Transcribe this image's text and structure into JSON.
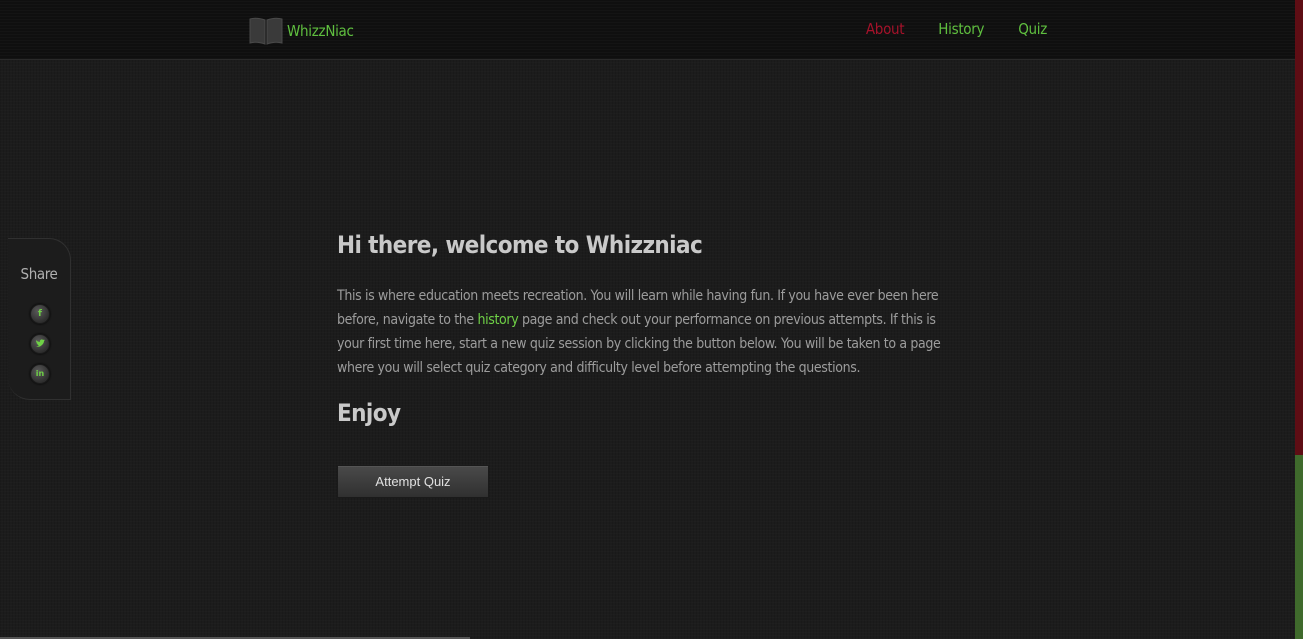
{
  "brand": {
    "name": "WhizzNiac",
    "icon": "book-icon"
  },
  "nav": {
    "items": [
      {
        "label": "About",
        "active": true
      },
      {
        "label": "History",
        "active": false
      },
      {
        "label": "Quiz",
        "active": false
      }
    ]
  },
  "share": {
    "title": "Share",
    "items": [
      {
        "icon": "facebook-icon",
        "glyph": "f"
      },
      {
        "icon": "twitter-icon",
        "glyph": "t"
      },
      {
        "icon": "linkedin-icon",
        "glyph": "in"
      }
    ]
  },
  "main": {
    "heading": "Hi there, welcome to Whizzniac",
    "intro_before_link": "This is where education meets recreation. You will learn while having fun. If you have ever been here before, navigate to the ",
    "intro_link": "history",
    "intro_after_link": " page and check out your performance on previous attempts. If this is your first time here, start a new quiz session by clicking the button below. You will be taken to a page where you will select quiz category and difficulty level before attempting the questions.",
    "subheading": "Enjoy",
    "button_label": "Attempt Quiz"
  },
  "colors": {
    "accent_green": "#5fbf3f",
    "active_red": "#a5122a",
    "background": "#1c1c1c"
  }
}
